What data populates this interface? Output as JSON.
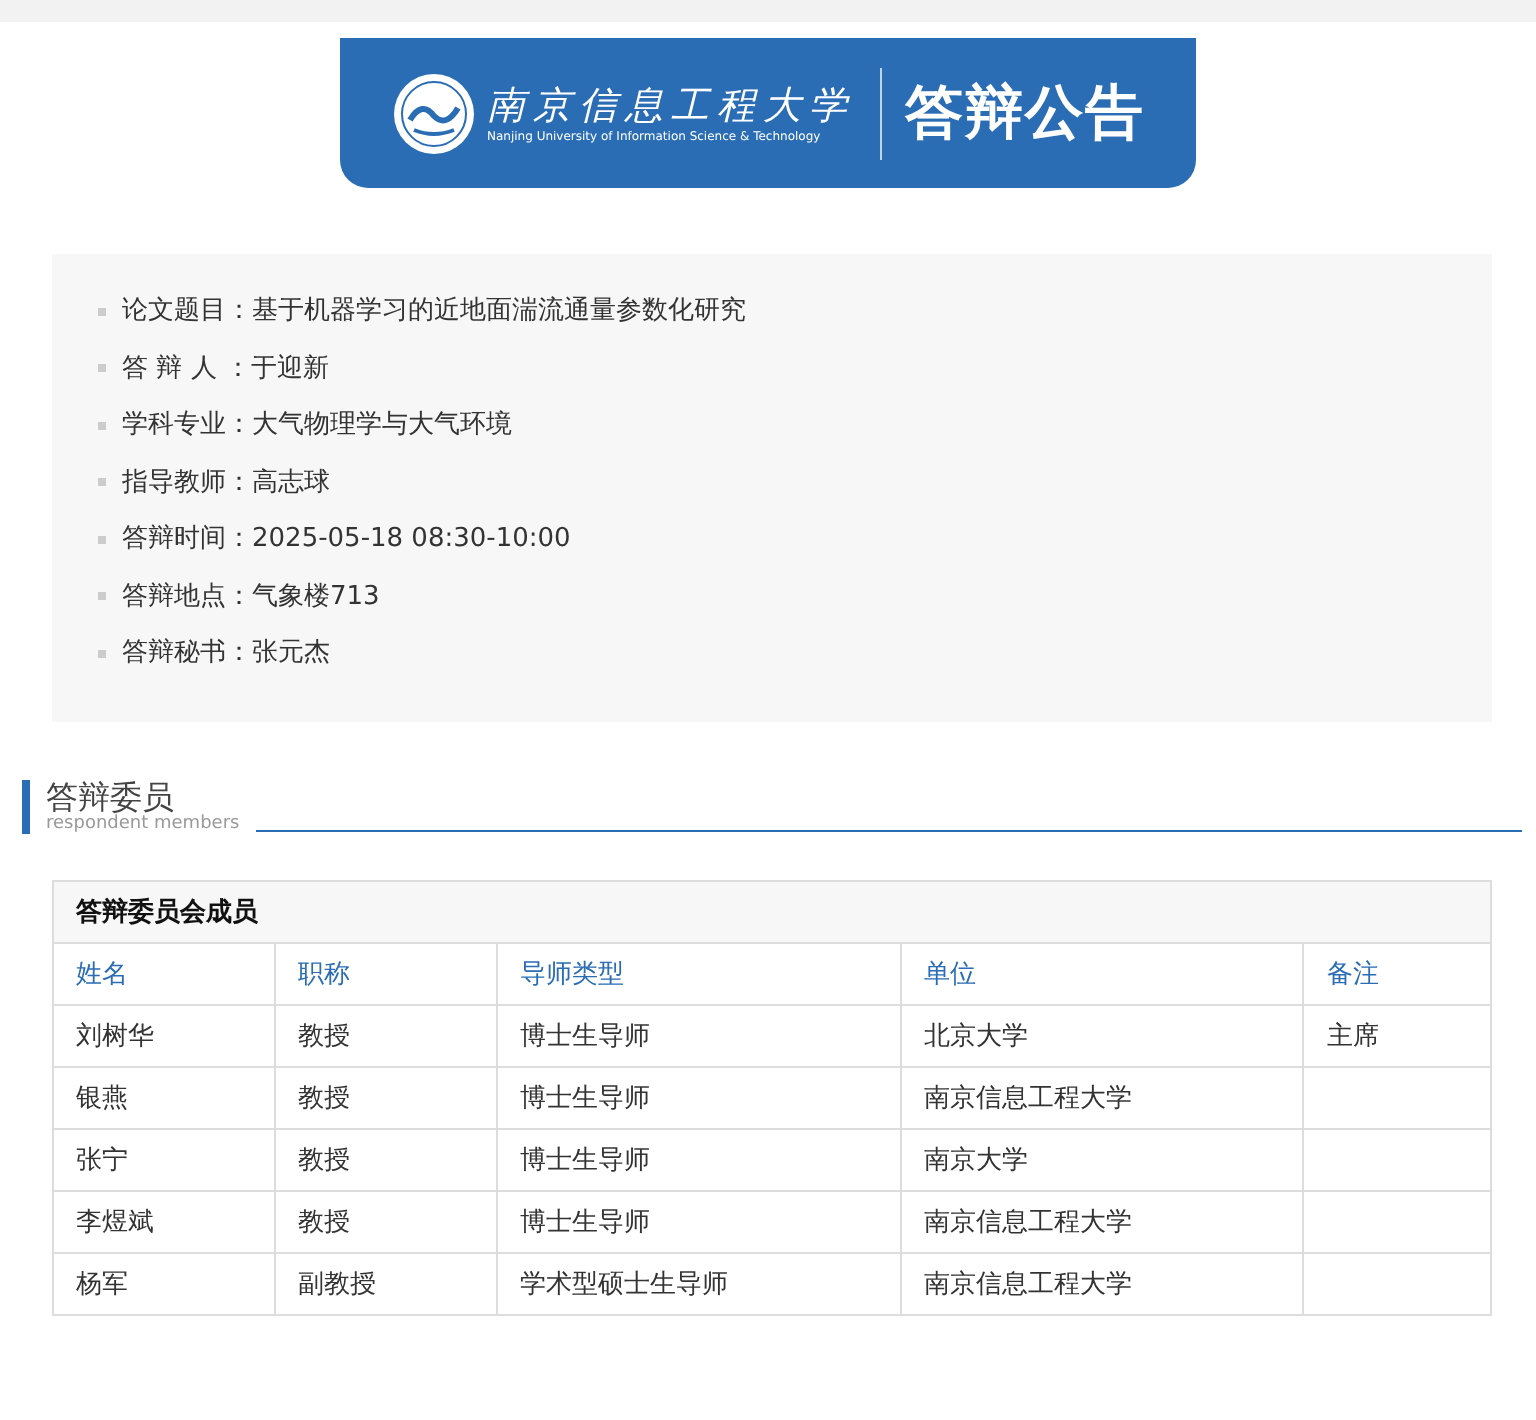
{
  "banner": {
    "logo_name": "南京信息工程大学",
    "logo_subtitle": "Nanjing University of Information Science & Technology",
    "title": "答辩公告"
  },
  "info": [
    {
      "label": "论文题目：",
      "value": "基于机器学习的近地面湍流通量参数化研究"
    },
    {
      "label": "答 辩 人 ：",
      "value": "于迎新"
    },
    {
      "label": "学科专业：",
      "value": "大气物理学与大气环境"
    },
    {
      "label": "指导教师：",
      "value": "高志球"
    },
    {
      "label": "答辩时间：",
      "value": "2025-05-18 08:30-10:00"
    },
    {
      "label": "答辩地点：",
      "value": "气象楼713"
    },
    {
      "label": "答辩秘书：",
      "value": "张元杰"
    }
  ],
  "section": {
    "title": "答辩委员",
    "subtitle": "respondent members"
  },
  "table": {
    "caption": "答辩委员会成员",
    "columns": [
      "姓名",
      "职称",
      "导师类型",
      "单位",
      "备注"
    ],
    "rows": [
      [
        "刘树华",
        "教授",
        "博士生导师",
        "北京大学",
        "主席"
      ],
      [
        "银燕",
        "教授",
        "博士生导师",
        "南京信息工程大学",
        ""
      ],
      [
        "张宁",
        "教授",
        "博士生导师",
        "南京大学",
        ""
      ],
      [
        "李煜斌",
        "教授",
        "博士生导师",
        "南京信息工程大学",
        ""
      ],
      [
        "杨军",
        "副教授",
        "学术型硕士生导师",
        "南京信息工程大学",
        ""
      ]
    ]
  }
}
